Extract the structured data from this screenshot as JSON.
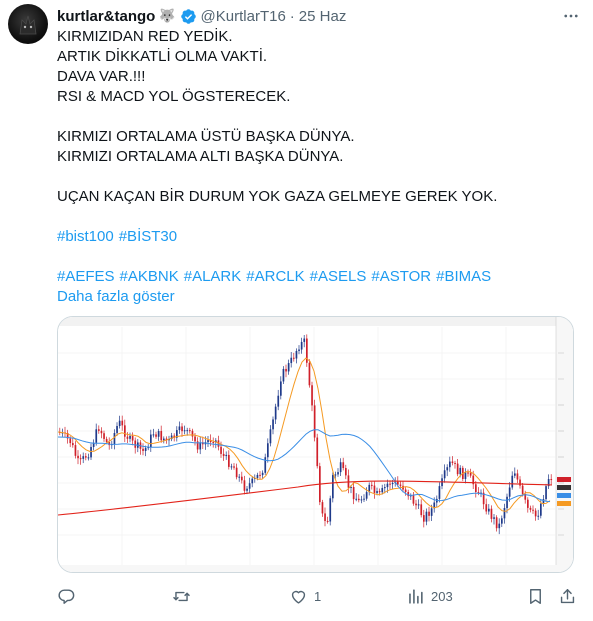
{
  "tweet": {
    "author_name": "kurtlar&tango",
    "author_emoji": "wolf-emoji",
    "verified": true,
    "handle": "@KurtlarT16",
    "separator": "·",
    "time": "25 Haz",
    "lines": [
      "KIRMIZIDAN RED YEDİK.",
      "ARTIK DİKKATLİ OLMA VAKTİ.",
      "DAVA VAR.!!!",
      "RSI & MACD YOL ÖGSTERECEK."
    ],
    "lines2": [
      "KIRMIZI ORTALAMA ÜSTÜ BAŞKA DÜNYA.",
      "KIRMIZI ORTALAMA ALTI BAŞKA DÜNYA."
    ],
    "line3": "UÇAN KAÇAN BİR DURUM YOK GAZA GELMEYE GEREK YOK.",
    "hashtags1": [
      "#bist100",
      "#BİST30"
    ],
    "hashtags2": [
      "#AEFES",
      "#AKBNK",
      "#ALARK",
      "#ARCLK",
      "#ASELS",
      "#ASTOR",
      "#BIMAS"
    ],
    "show_more": "Daha fazla göster"
  },
  "actions": {
    "reply_count": "",
    "retweet_count": "",
    "like_count": "1",
    "views_count": "203"
  },
  "colors": {
    "accent": "#1d9bf0",
    "muted": "#536471",
    "text": "#0f1419",
    "border": "#cfd9de",
    "candle_up": "#1f3a8a",
    "candle_down": "#d0202a",
    "ma_short": "#f59a23",
    "ma_mid": "#3a8ee6",
    "ma_long": "#e2231a"
  },
  "icons": {
    "more": "more-icon",
    "reply": "reply-icon",
    "retweet": "retweet-icon",
    "like": "heart-icon",
    "views": "views-icon",
    "bookmark": "bookmark-icon",
    "share": "share-icon"
  }
}
